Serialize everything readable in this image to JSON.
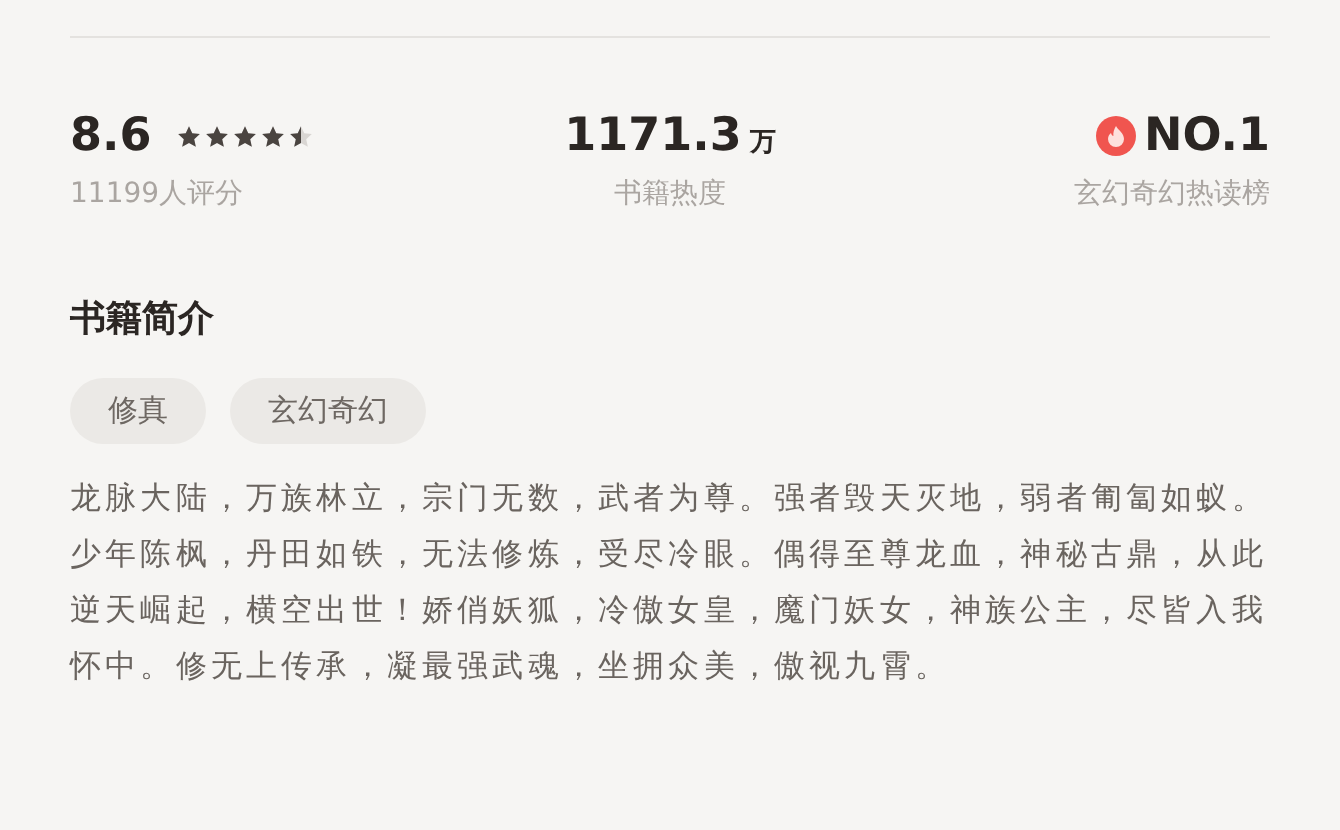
{
  "stats": [
    {
      "kind": "rating",
      "value": "8.6",
      "stars": 4.5,
      "caption": "11199人评分"
    },
    {
      "kind": "heat",
      "value": "1171.3",
      "unit": "万",
      "caption": "书籍热度"
    },
    {
      "kind": "rank",
      "value": "NO.1",
      "caption": "玄幻奇幻热读榜"
    }
  ],
  "intro": {
    "title": "书籍简介",
    "tags": [
      "修真",
      "玄幻奇幻"
    ],
    "text": "龙脉大陆，万族林立，宗门无数，武者为尊。强者毁天灭地，弱者匍匐如蚁。少年陈枫，丹田如铁，无法修炼，受尽冷眼。偶得至尊龙血，神秘古鼎，从此逆天崛起，横空出世！娇俏妖狐，冷傲女皇，魔门妖女，神族公主，尽皆入我怀中。修无上传承，凝最强武魂，坐拥众美，傲视九霄。"
  }
}
